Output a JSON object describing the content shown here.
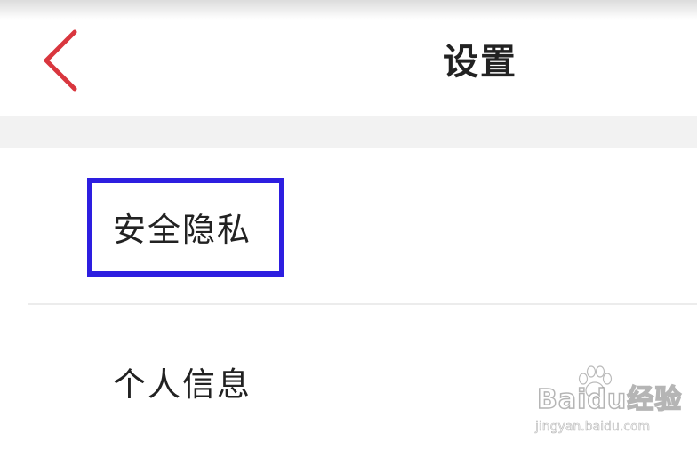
{
  "header": {
    "title": "设置",
    "back_icon": "chevron-left-icon",
    "accent_color": "#d9363e"
  },
  "settings_list": {
    "items": [
      {
        "label": "安全隐私",
        "highlighted": true
      },
      {
        "label": "个人信息",
        "highlighted": false
      }
    ]
  },
  "annotation": {
    "highlight_color": "#2d1ee0"
  },
  "watermark": {
    "logo_text": "Baidu经验",
    "url": "jingyan.baidu.com"
  }
}
